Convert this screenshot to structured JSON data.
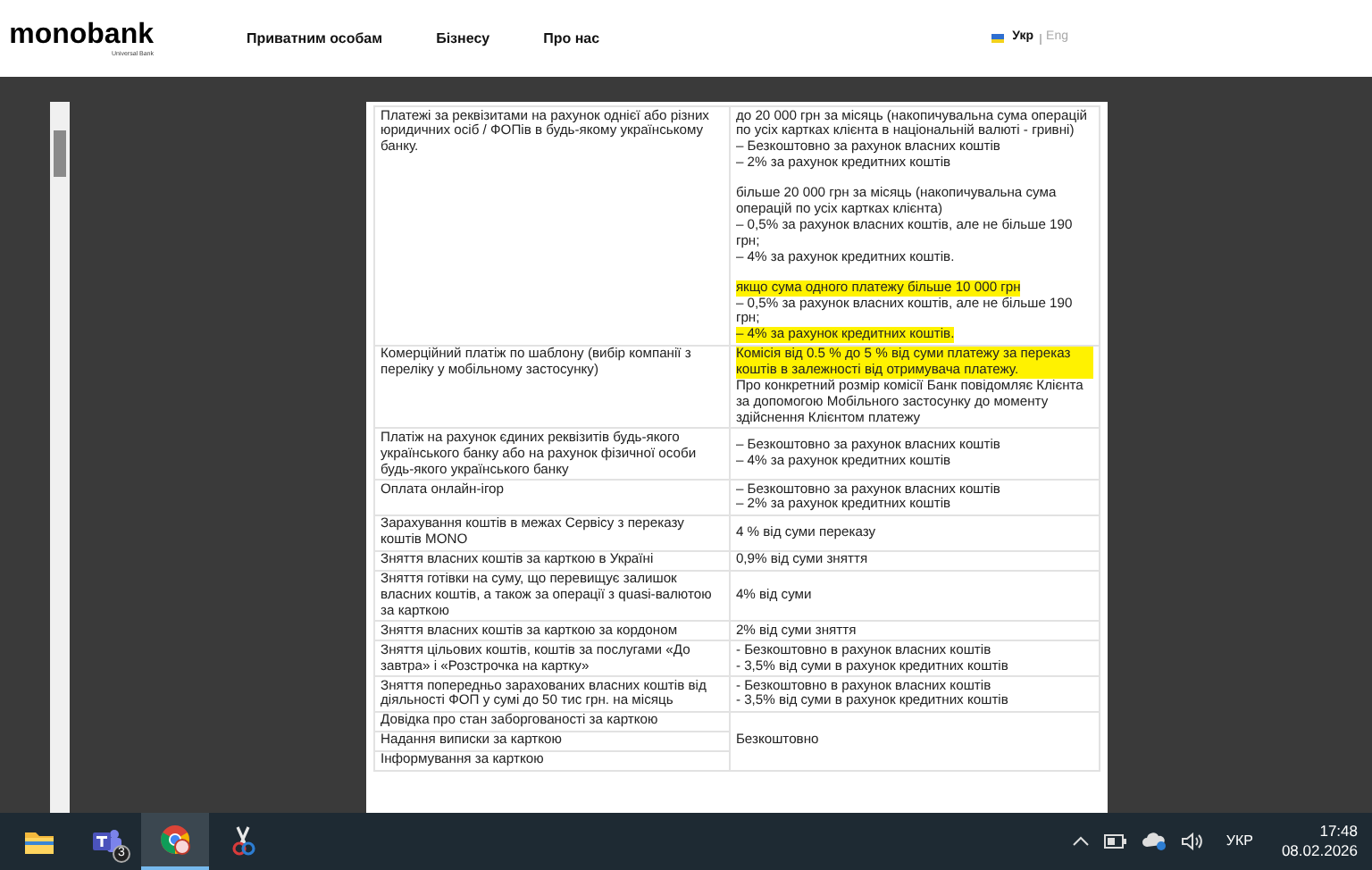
{
  "header": {
    "logo": "monobank",
    "logo_sub": "Universal Bank",
    "nav": [
      "Приватним особам",
      "Бізнесу",
      "Про нас"
    ],
    "languages": [
      {
        "label": "Укр",
        "selected": true
      },
      {
        "label": "Eng",
        "selected": false
      }
    ]
  },
  "table": {
    "rows": [
      {
        "kind": "single",
        "service": "Платежі за реквізитами на рахунок однієї або різних юридичних осіб / ФОПів в будь-якому українському банку.",
        "fee": [
          [
            {
              "text": "до 20 000 грн за місяць (накопичувальна сума операцій по усіх картках клієнта в національній валюті - гривні)",
              "highlighted": false
            },
            {
              "text": "– Безкоштовно за рахунок власних коштів",
              "highlighted": false
            },
            {
              "text": "– 2% за рахунок кредитних коштів",
              "highlighted": false
            }
          ],
          [
            {
              "text": "більше 20 000 грн за місяць (накопичувальна сума операцій по усіх картках клієнта)",
              "highlighted": false
            },
            {
              "text": "– 0,5% за рахунок власних коштів, але не більше 190 грн;",
              "highlighted": false
            },
            {
              "text": "– 4% за рахунок кредитних коштів.",
              "highlighted": false
            }
          ],
          [
            {
              "text": "якщо сума одного платежу більше 10 000 грн",
              "highlighted": true
            },
            {
              "text": "– 0,5% за рахунок власних коштів, але не більше 190 грн;",
              "highlighted": false
            },
            {
              "text": "– 4% за рахунок кредитних коштів.",
              "highlighted": true
            }
          ]
        ]
      },
      {
        "kind": "single",
        "service": "Комерційний платіж по шаблону (вибір компанії з переліку у мобільному застосунку)",
        "fee": [
          [
            {
              "text": "Комісія від 0.5 % до 5 % від суми платежу за переказ коштів в залежності від отримувача платежу.",
              "highlighted": true
            },
            {
              "text": "Про конкретний розмір комісії Банк повідомляє Клієнта за допомогою Мобільного застосунку до моменту здійснення Клієнтом платежу",
              "highlighted": false
            }
          ]
        ]
      },
      {
        "kind": "single",
        "service": "Платіж на рахунок єдиних реквізитів будь-якого українського банку або на рахунок фізичної особи будь-якого українського банку",
        "fee": [
          [
            {
              "text": "– Безкоштовно за рахунок власних коштів",
              "highlighted": false
            },
            {
              "text": "– 4% за рахунок кредитних коштів",
              "highlighted": false
            }
          ]
        ]
      },
      {
        "kind": "single",
        "service": "Оплата онлайн-ігор",
        "fee": [
          [
            {
              "text": "– Безкоштовно за рахунок власних коштів",
              "highlighted": false
            },
            {
              "text": "– 2% за рахунок кредитних коштів",
              "highlighted": false
            }
          ]
        ]
      },
      {
        "kind": "single",
        "service": "Зарахування коштів в межах Сервісу з переказу коштів MONO",
        "fee": [
          [
            {
              "text": "4 % від суми переказу",
              "highlighted": false
            }
          ]
        ]
      },
      {
        "kind": "single",
        "service": "Зняття власних коштів за карткою в Україні",
        "fee": [
          [
            {
              "text": "0,9% від суми зняття",
              "highlighted": false
            }
          ]
        ]
      },
      {
        "kind": "single",
        "service": "Зняття готівки на суму, що перевищує залишок власних коштів, а також за операції з quasi-валютою за карткою",
        "fee": [
          [
            {
              "text": "4% від суми",
              "highlighted": false
            }
          ]
        ]
      },
      {
        "kind": "single",
        "service": "Зняття власних коштів за карткою за кордоном",
        "fee": [
          [
            {
              "text": "2% від суми зняття",
              "highlighted": false
            }
          ]
        ]
      },
      {
        "kind": "single",
        "service": "Зняття цільових коштів, коштів за послугами «До завтра» і «Розстрочка на картку»",
        "fee": [
          [
            {
              "text": "- Безкоштовно в рахунок власних коштів",
              "highlighted": false
            },
            {
              "text": "- 3,5% від суми в рахунок кредитних коштів",
              "highlighted": false
            }
          ]
        ]
      },
      {
        "kind": "single",
        "service": "Зняття попередньо зарахованих власних коштів від діяльності ФОП у сумі до 50 тис грн. на місяць",
        "fee": [
          [
            {
              "text": "- Безкоштовно в рахунок власних коштів",
              "highlighted": false
            },
            {
              "text": "- 3,5% від суми в рахунок кредитних коштів",
              "highlighted": false
            }
          ]
        ]
      },
      {
        "kind": "merged",
        "services": [
          "Довідка про стан заборгованості за карткою",
          "Надання виписки за карткою",
          "Інформування за карткою"
        ],
        "fee_text": "Безкоштовно"
      }
    ]
  },
  "taskbar": {
    "apps": [
      {
        "kind": "folder",
        "active": false
      },
      {
        "kind": "teams",
        "active": false,
        "badge": "3"
      },
      {
        "kind": "browser",
        "active": true
      },
      {
        "kind": "scissors",
        "active": false
      }
    ],
    "language": "УКР",
    "time": "17:48",
    "date": "08.02.2026"
  }
}
